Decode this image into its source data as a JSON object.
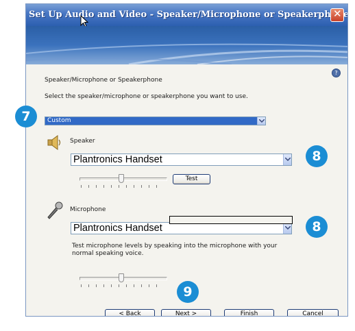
{
  "window": {
    "title": "Set Up Audio and Video - Speaker/Microphone or Speakerphone",
    "close_glyph": "✕"
  },
  "page": {
    "heading": "Speaker/Microphone or Speakerphone",
    "instruction": "Select the speaker/microphone or speakerphone you want to use.",
    "device_selected": "Custom"
  },
  "speaker": {
    "label": "Speaker",
    "device": "Plantronics Handset",
    "test_button": "Test",
    "volume_level_fraction": 0.45,
    "icon": "speaker-icon"
  },
  "microphone": {
    "label": "Microphone",
    "device": "Plantronics Handset",
    "hint": "Test microphone levels by speaking into the microphone with your normal speaking voice.",
    "hint_line1": "Test microphone levels by speaking into the microphone with your",
    "hint_line2": "normal speaking voice.",
    "volume_level_fraction": 0.45,
    "icon": "microphone-icon"
  },
  "buttons": {
    "back": "< Back",
    "next": "Next >",
    "finish": "Finish",
    "cancel": "Cancel"
  },
  "callouts": {
    "device_selector": "7",
    "speaker_device": "8",
    "microphone_device": "8",
    "next": "9"
  },
  "colors": {
    "callout": "#1b8dd4",
    "title_bar": "#2c5fb0",
    "selection": "#3169c6"
  }
}
